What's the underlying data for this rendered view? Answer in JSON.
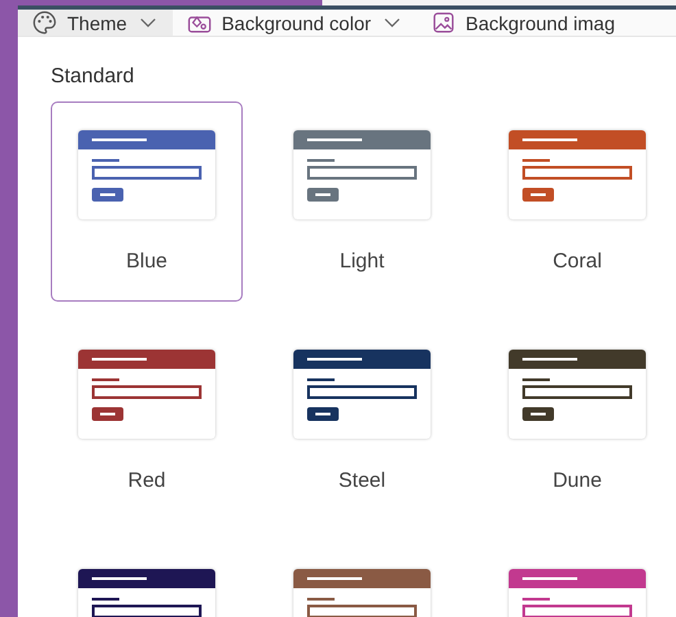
{
  "toolbar": [
    {
      "label": "Theme",
      "selected": true,
      "dropdown": true
    },
    {
      "label": "Background color",
      "selected": false,
      "dropdown": true
    },
    {
      "label": "Background imag",
      "selected": false,
      "dropdown": false
    }
  ],
  "section": {
    "title": "Standard"
  },
  "themes": [
    {
      "name": "Blue",
      "selected": true,
      "color": "#4a62b0"
    },
    {
      "name": "Light",
      "selected": false,
      "color": "#68747f"
    },
    {
      "name": "Coral",
      "selected": false,
      "color": "#c24e25"
    },
    {
      "name": "Red",
      "selected": false,
      "color": "#9c3434"
    },
    {
      "name": "Steel",
      "selected": false,
      "color": "#17335f"
    },
    {
      "name": "Dune",
      "selected": false,
      "color": "#423a2a"
    },
    {
      "selected": false,
      "color": "#1e1654"
    },
    {
      "selected": false,
      "color": "#8a5a44"
    },
    {
      "selected": false,
      "color": "#c2398f"
    }
  ]
}
